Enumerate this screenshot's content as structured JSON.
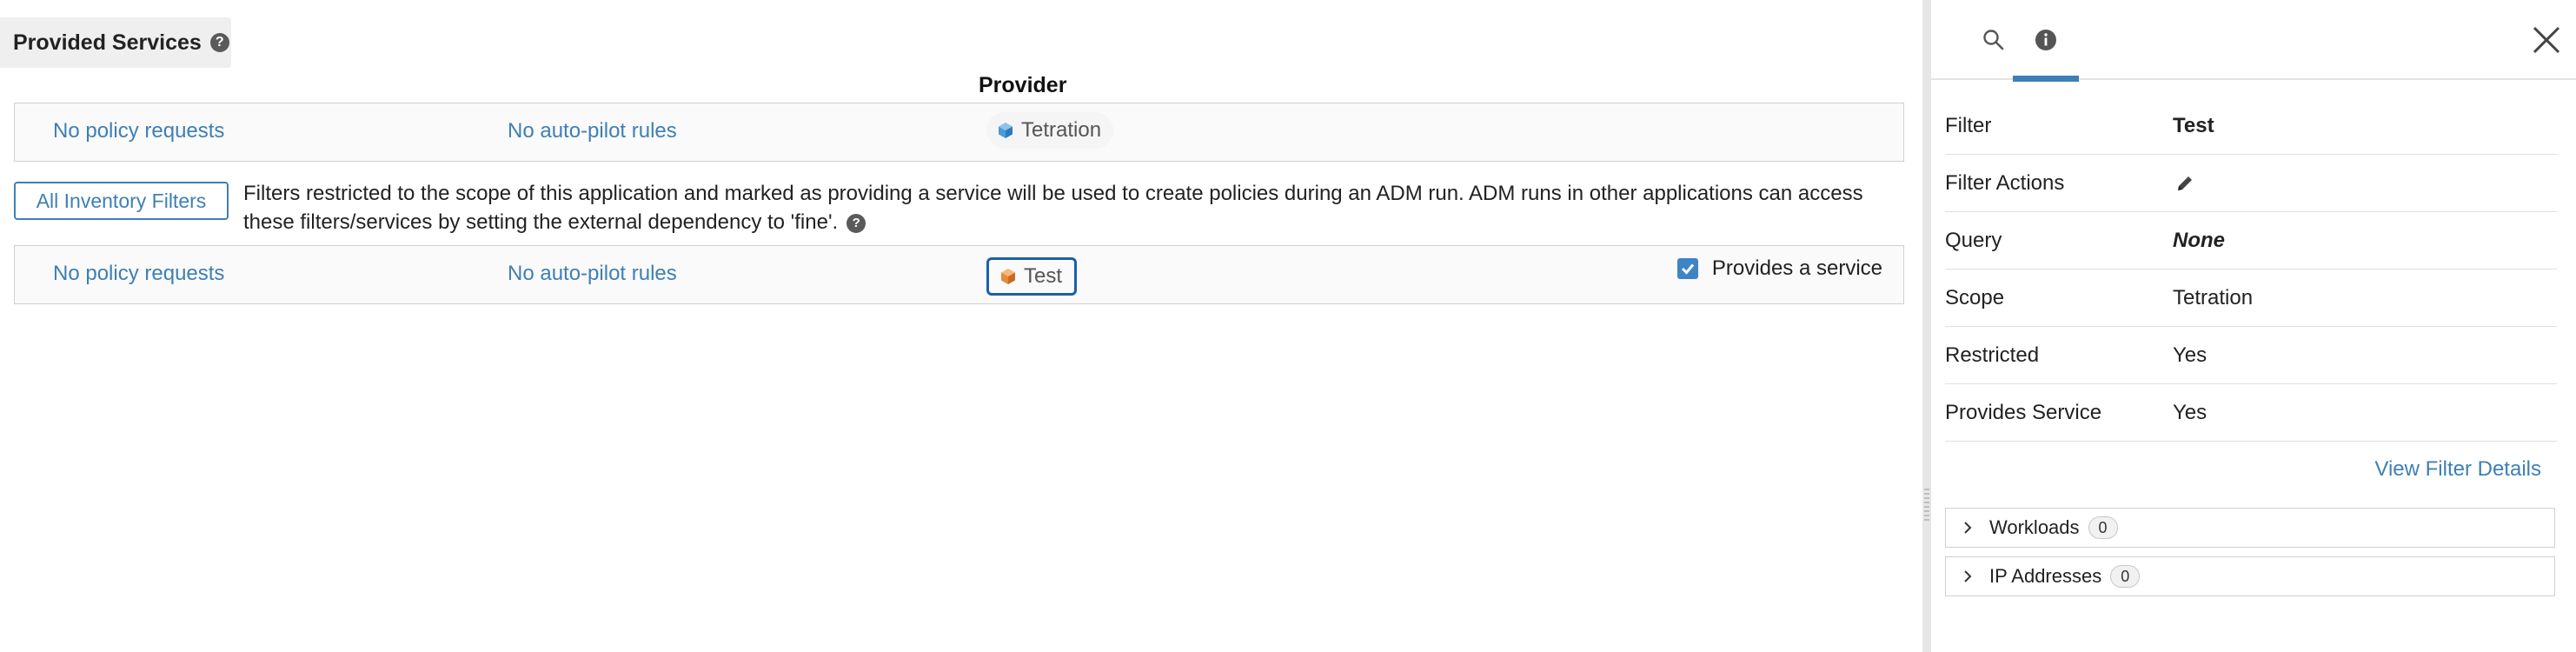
{
  "section": {
    "title": "Provided Services"
  },
  "columns": {
    "provider": "Provider"
  },
  "rows": [
    {
      "policy": "No policy requests",
      "autopilot": "No auto-pilot rules",
      "provider": "Tetration"
    },
    {
      "policy": "No policy requests",
      "autopilot": "No auto-pilot rules",
      "provider": "Test",
      "provides_service_label": "Provides a service",
      "provides_service_checked": true
    }
  ],
  "inventory": {
    "button_label": "All Inventory Filters",
    "description": "Filters restricted to the scope of this application and marked as providing a service will be used to create policies during an ADM run. ADM runs in other applications can access these filters/services by setting the external dependency to 'fine'."
  },
  "panel": {
    "tabs": [
      {
        "icon": "search-icon",
        "active": false
      },
      {
        "icon": "info-icon",
        "active": true
      }
    ],
    "properties": [
      {
        "label": "Filter",
        "value": "Test"
      },
      {
        "label": "Filter Actions",
        "value": ""
      },
      {
        "label": "Query",
        "value": "None"
      },
      {
        "label": "Scope",
        "value": "Tetration"
      },
      {
        "label": "Restricted",
        "value": "Yes"
      },
      {
        "label": "Provides Service",
        "value": "Yes"
      }
    ],
    "view_details": "View Filter Details",
    "sections": [
      {
        "label": "Workloads",
        "count": "0"
      },
      {
        "label": "IP Addresses",
        "count": "0"
      }
    ]
  },
  "colors": {
    "link": "#3e7fb5",
    "accent": "#3f7fb5",
    "selected_border": "#1d5fa8",
    "cube_blue": "#4a9bd6",
    "cube_orange": "#e8883a"
  }
}
